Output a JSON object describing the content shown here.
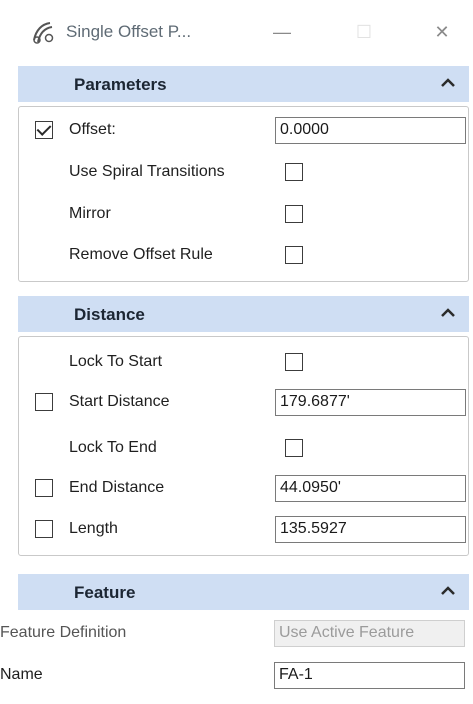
{
  "window": {
    "title": "Single Offset P...",
    "icon": "offset-tool-icon",
    "buttons": {
      "minimize": "—",
      "maximize": "☐",
      "close": "✕"
    }
  },
  "parameters": {
    "title": "Parameters",
    "offset_label": "Offset:",
    "offset_checked": true,
    "offset_value": "0.0000",
    "spiral_label": "Use Spiral Transitions",
    "spiral_checked": false,
    "mirror_label": "Mirror",
    "mirror_checked": false,
    "remove_rule_label": "Remove Offset Rule",
    "remove_rule_checked": false
  },
  "distance": {
    "title": "Distance",
    "lock_start_label": "Lock To Start",
    "lock_start_checked": false,
    "start_label": "Start Distance",
    "start_checked": false,
    "start_value": "179.6877'",
    "lock_end_label": "Lock To End",
    "lock_end_checked": false,
    "end_label": "End Distance",
    "end_checked": false,
    "end_value": "44.0950'",
    "length_label": "Length",
    "length_checked": false,
    "length_value": "135.5927"
  },
  "feature": {
    "title": "Feature",
    "definition_label": "Feature Definition",
    "definition_value": "Use Active Feature",
    "name_label": "Name",
    "name_value": "FA-1"
  },
  "colors": {
    "header_bg": "#cfdef3",
    "title_text": "#5f6b75"
  }
}
